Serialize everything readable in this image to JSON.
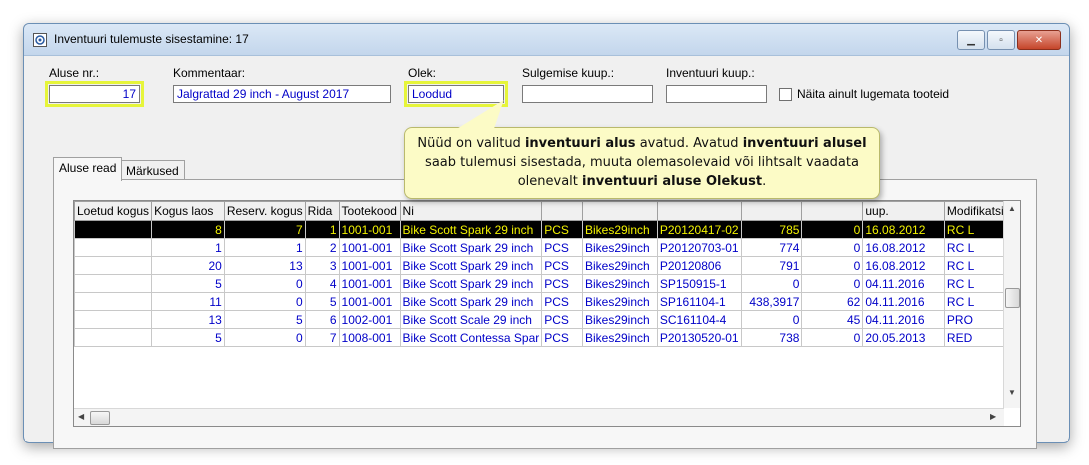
{
  "window": {
    "title": "Inventuuri tulemuste sisestamine: 17"
  },
  "form": {
    "aluse_label": "Aluse nr.:",
    "aluse_value": "17",
    "kommentaar_label": "Kommentaar:",
    "kommentaar_value": "Jalgrattad 29 inch - August 2017",
    "olek_label": "Olek:",
    "olek_value": "Loodud",
    "sulgemise_label": "Sulgemise kuup.:",
    "sulgemise_value": "",
    "inventuuri_label": "Inventuuri kuup.:",
    "inventuuri_value": "",
    "checkbox_label": "Näita ainult lugemata tooteid"
  },
  "tabs": [
    {
      "label": "Aluse read"
    },
    {
      "label": "Märkused"
    }
  ],
  "tooltip": {
    "t1": "Nüüd on valitud ",
    "b1": "inventuuri alus",
    "t2": " avatud. Avatud ",
    "b2": "inventuuri alusel",
    "t3": " saab tulemusi sisestada, muuta olemasolevaid või lihtsalt vaadata olenevalt ",
    "b3": "inventuuri aluse Olekust",
    "t4": "."
  },
  "table": {
    "columns": [
      "Loetud kogus",
      "Kogus laos",
      "Reserv. kogus",
      "Rida",
      "Tootekood",
      "Ni",
      "",
      "",
      "",
      "",
      "",
      "uup.",
      "Modifikatsioo"
    ],
    "rows": [
      [
        "",
        "8",
        "7",
        "1",
        "1001-001",
        "Bike Scott Spark 29 inch",
        "PCS",
        "Bikes29inch",
        "P20120417-02",
        "785",
        "0",
        "16.08.2012",
        "RC L"
      ],
      [
        "",
        "1",
        "1",
        "2",
        "1001-001",
        "Bike Scott Spark 29 inch",
        "PCS",
        "Bikes29inch",
        "P20120703-01",
        "774",
        "0",
        "16.08.2012",
        "RC L"
      ],
      [
        "",
        "20",
        "13",
        "3",
        "1001-001",
        "Bike Scott Spark 29 inch",
        "PCS",
        "Bikes29inch",
        "P20120806",
        "791",
        "0",
        "16.08.2012",
        "RC L"
      ],
      [
        "",
        "5",
        "0",
        "4",
        "1001-001",
        "Bike Scott Spark 29 inch",
        "PCS",
        "Bikes29inch",
        "SP150915-1",
        "0",
        "0",
        "04.11.2016",
        "RC L"
      ],
      [
        "",
        "11",
        "0",
        "5",
        "1001-001",
        "Bike Scott Spark 29 inch",
        "PCS",
        "Bikes29inch",
        "SP161104-1",
        "438,3917",
        "62",
        "04.11.2016",
        "RC L"
      ],
      [
        "",
        "13",
        "5",
        "6",
        "1002-001",
        "Bike Scott Scale 29 inch",
        "PCS",
        "Bikes29inch",
        "SC161104-4",
        "0",
        "45",
        "04.11.2016",
        "PRO"
      ],
      [
        "",
        "5",
        "0",
        "7",
        "1008-001",
        "Bike Scott Contessa Spar",
        "PCS",
        "Bikes29inch",
        "P20130520-01",
        "738",
        "0",
        "20.05.2013",
        "RED"
      ]
    ],
    "selected_row": 0
  }
}
